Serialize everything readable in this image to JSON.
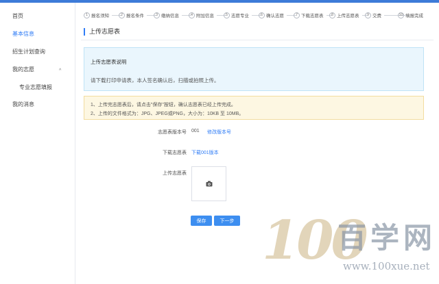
{
  "sidebar": {
    "items": [
      {
        "label": "首页"
      },
      {
        "label": "基本信息"
      },
      {
        "label": "招生计划查询"
      },
      {
        "label": "我的志愿"
      },
      {
        "label": "专业志愿填报"
      },
      {
        "label": "我的消息"
      }
    ],
    "active_index": 1,
    "caret_glyph": "^"
  },
  "steps": [
    {
      "num": "1",
      "label": "报名须知"
    },
    {
      "num": "2",
      "label": "报名条件"
    },
    {
      "num": "3",
      "label": "缴纳信息"
    },
    {
      "num": "4",
      "label": "附加信息"
    },
    {
      "num": "5",
      "label": "志愿专业"
    },
    {
      "num": "6",
      "label": "确认志愿"
    },
    {
      "num": "7",
      "label": "下载志愿表"
    },
    {
      "num": "8",
      "label": "上传志愿表"
    },
    {
      "num": "9",
      "label": "交费"
    },
    {
      "num": "10",
      "label": "填报完成"
    }
  ],
  "page": {
    "title": "上传志愿表"
  },
  "info": {
    "title": "上传志愿表说明",
    "text": "请下载打印申请表，本人签名确认后，扫描或拍照上传。"
  },
  "warning": {
    "lines": [
      "1、上传完志愿表后，请点击\"保存\"按钮，确认志愿表已经上传完成。",
      "2、上传的文件格式为：JPG、JPEG或PNG，大小为：10KB 至 10MB。"
    ]
  },
  "form": {
    "version_label": "志愿表版本号",
    "version_value": "001",
    "modify_link": "修改版本号",
    "download_label": "下载志愿表",
    "download_link": "下载001版本",
    "upload_label": "上传志愿表"
  },
  "buttons": {
    "save": "保存",
    "next": "下一步"
  },
  "watermark": {
    "number": "100",
    "name": "百学网",
    "url": "www.100xue.net"
  },
  "colors": {
    "accent": "#2f7cf6",
    "button": "#3d8ef0",
    "info_bg": "#eaf6fd",
    "warning_bg": "#fdf7e2"
  }
}
